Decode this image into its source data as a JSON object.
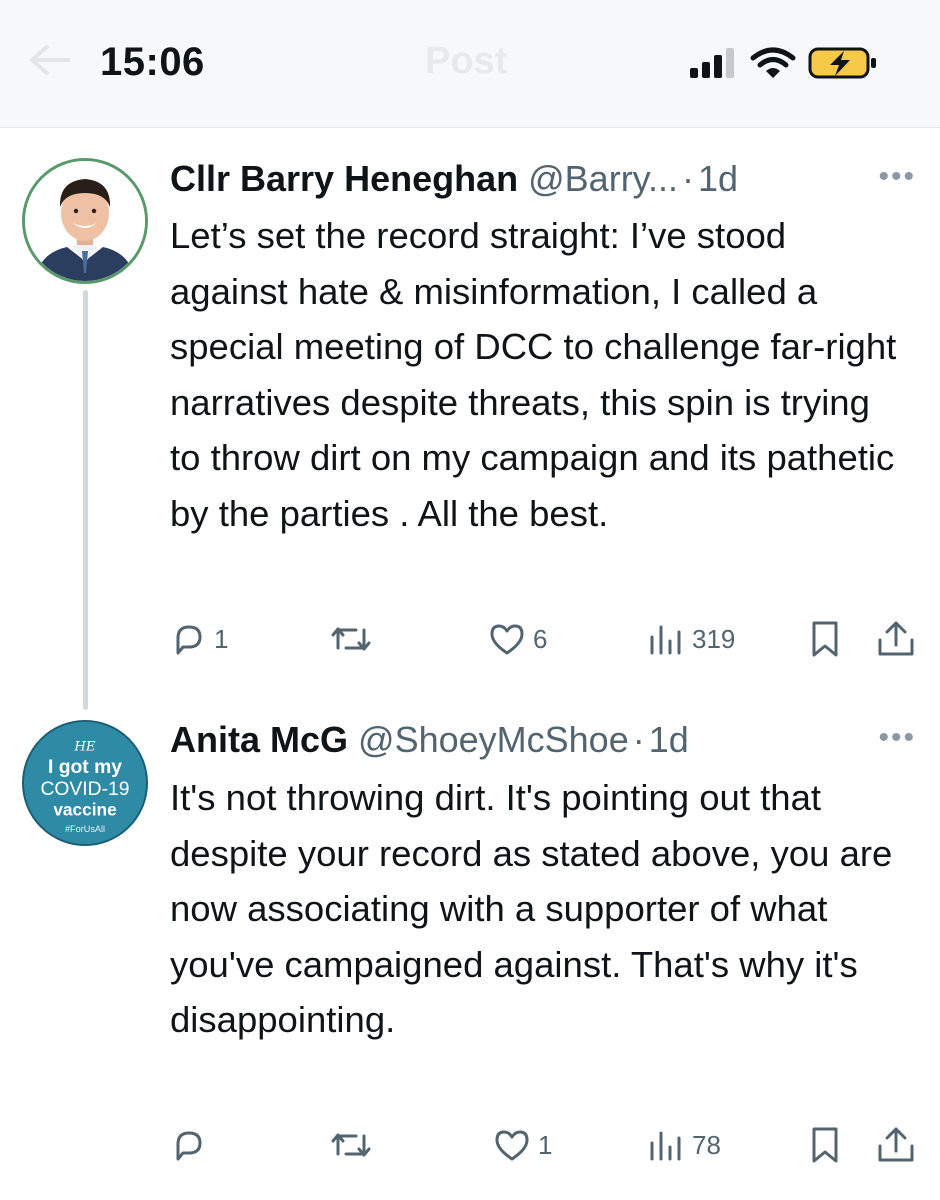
{
  "status_bar": {
    "time": "15:06",
    "header_title": "Post"
  },
  "tweets": [
    {
      "display_name": "Cllr Barry Heneghan",
      "handle": "@Barry...",
      "separator": "·",
      "time": "1d",
      "more": "•••",
      "text": "Let’s set the record straight:  I’ve stood against hate & misinformation, I called a special meeting of DCC to challenge far-right narratives despite threats, this spin is trying to throw dirt on my campaign and its pathetic by the parties . All the best.",
      "replies": "1",
      "reposts": "",
      "likes": "6",
      "views": "319"
    },
    {
      "display_name": "Anita McG",
      "handle": "@ShoeyMcShoe",
      "separator": "·",
      "time": "1d",
      "more": "•••",
      "text": "It's not throwing dirt. It's pointing out that despite your record as stated above, you are now associating with a supporter of what you've campaigned against. That's why it's disappointing.",
      "replies": "",
      "reposts": "",
      "likes": "1",
      "views": "78",
      "avatar_badge": {
        "logo": "HE",
        "line1": "I got my",
        "line2": "COVID-19",
        "line3": "vaccine",
        "line4": "#ForUsAll"
      }
    }
  ],
  "colors": {
    "text": "#0f1419",
    "secondary": "#536471",
    "thread_line": "#cfd9de",
    "battery_fill": "#f7c948"
  },
  "icons": [
    "reply-icon",
    "repost-icon",
    "like-icon",
    "views-icon",
    "bookmark-icon",
    "share-icon",
    "signal-icon",
    "wifi-icon",
    "battery-charging-icon",
    "back-arrow-icon"
  ]
}
